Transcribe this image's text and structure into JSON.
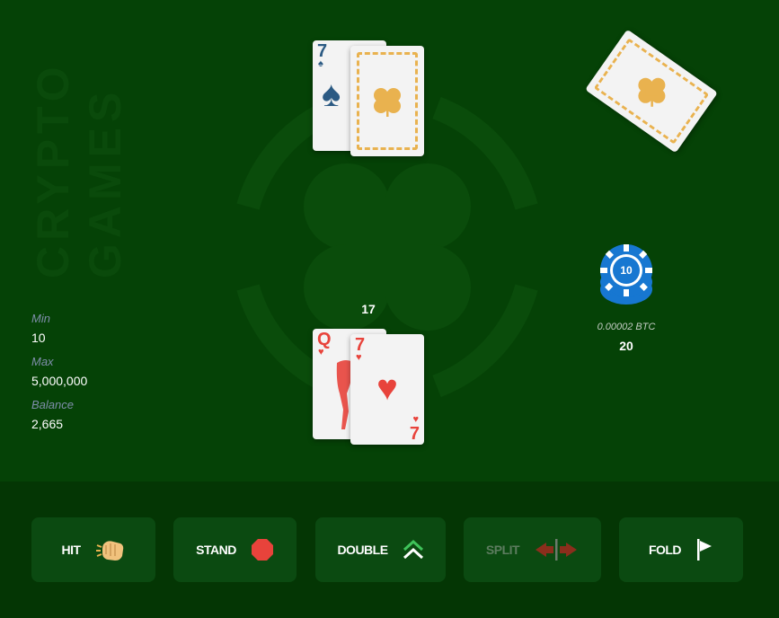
{
  "brand": {
    "line1": "CRYPTO",
    "line2": "GAMES"
  },
  "limits": {
    "min_label": "Min",
    "min_value": "10",
    "max_label": "Max",
    "max_value": "5,000,000",
    "balance_label": "Balance",
    "balance_value": "2,665"
  },
  "dealer": {
    "cards": [
      {
        "rank": "7",
        "suit": "♠",
        "face_up": true
      },
      {
        "face_up": false
      }
    ]
  },
  "player": {
    "score": "17",
    "cards": [
      {
        "rank": "Q",
        "suit": "♥"
      },
      {
        "rank": "7",
        "suit": "♥"
      }
    ]
  },
  "bet": {
    "chip_value": "10",
    "btc_amount": "0.00002 BTC",
    "amount": "20"
  },
  "actions": {
    "hit": {
      "label": "HIT",
      "icon": "hand-tap-icon",
      "enabled": true
    },
    "stand": {
      "label": "STAND",
      "icon": "stop-octagon-icon",
      "enabled": true
    },
    "double": {
      "label": "DOUBLE",
      "icon": "double-chevron-up-icon",
      "enabled": true
    },
    "split": {
      "label": "SPLIT",
      "icon": "split-arrows-icon",
      "enabled": false
    },
    "fold": {
      "label": "FOLD",
      "icon": "flag-icon",
      "enabled": true
    }
  },
  "colors": {
    "felt": "#054206",
    "bottom_bar": "#043604",
    "button_bg": "#0b4a11",
    "card_back_accent": "#e9b24f",
    "chip_blue": "#1777d1",
    "heart_red": "#e8433b",
    "spade_blue": "#2b5a83"
  }
}
